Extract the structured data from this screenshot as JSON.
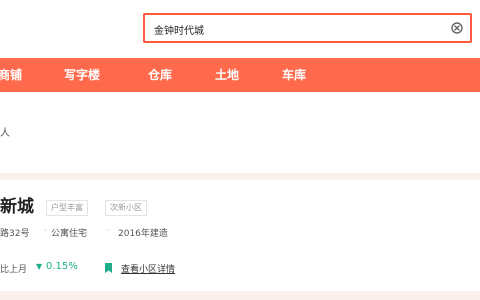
{
  "search": {
    "value": "金钟时代城"
  },
  "nav": {
    "items": [
      {
        "label": "商铺"
      },
      {
        "label": "写字楼"
      },
      {
        "label": "仓库"
      },
      {
        "label": "土地"
      },
      {
        "label": "车库"
      }
    ]
  },
  "section": {
    "secondary_text": "人"
  },
  "estate": {
    "title": "新城",
    "tags": [
      "户型丰富",
      "次新小区"
    ],
    "address": "路32号",
    "type": "公寓住宅",
    "built": "2016年建造",
    "mom_label": "比上月",
    "mom_value": "0.15%",
    "detail_link": "查看小区详情"
  },
  "colors": {
    "brand": "#ff6a4d",
    "search_border": "#ff5a3d",
    "trend_down": "#1fae8a"
  }
}
